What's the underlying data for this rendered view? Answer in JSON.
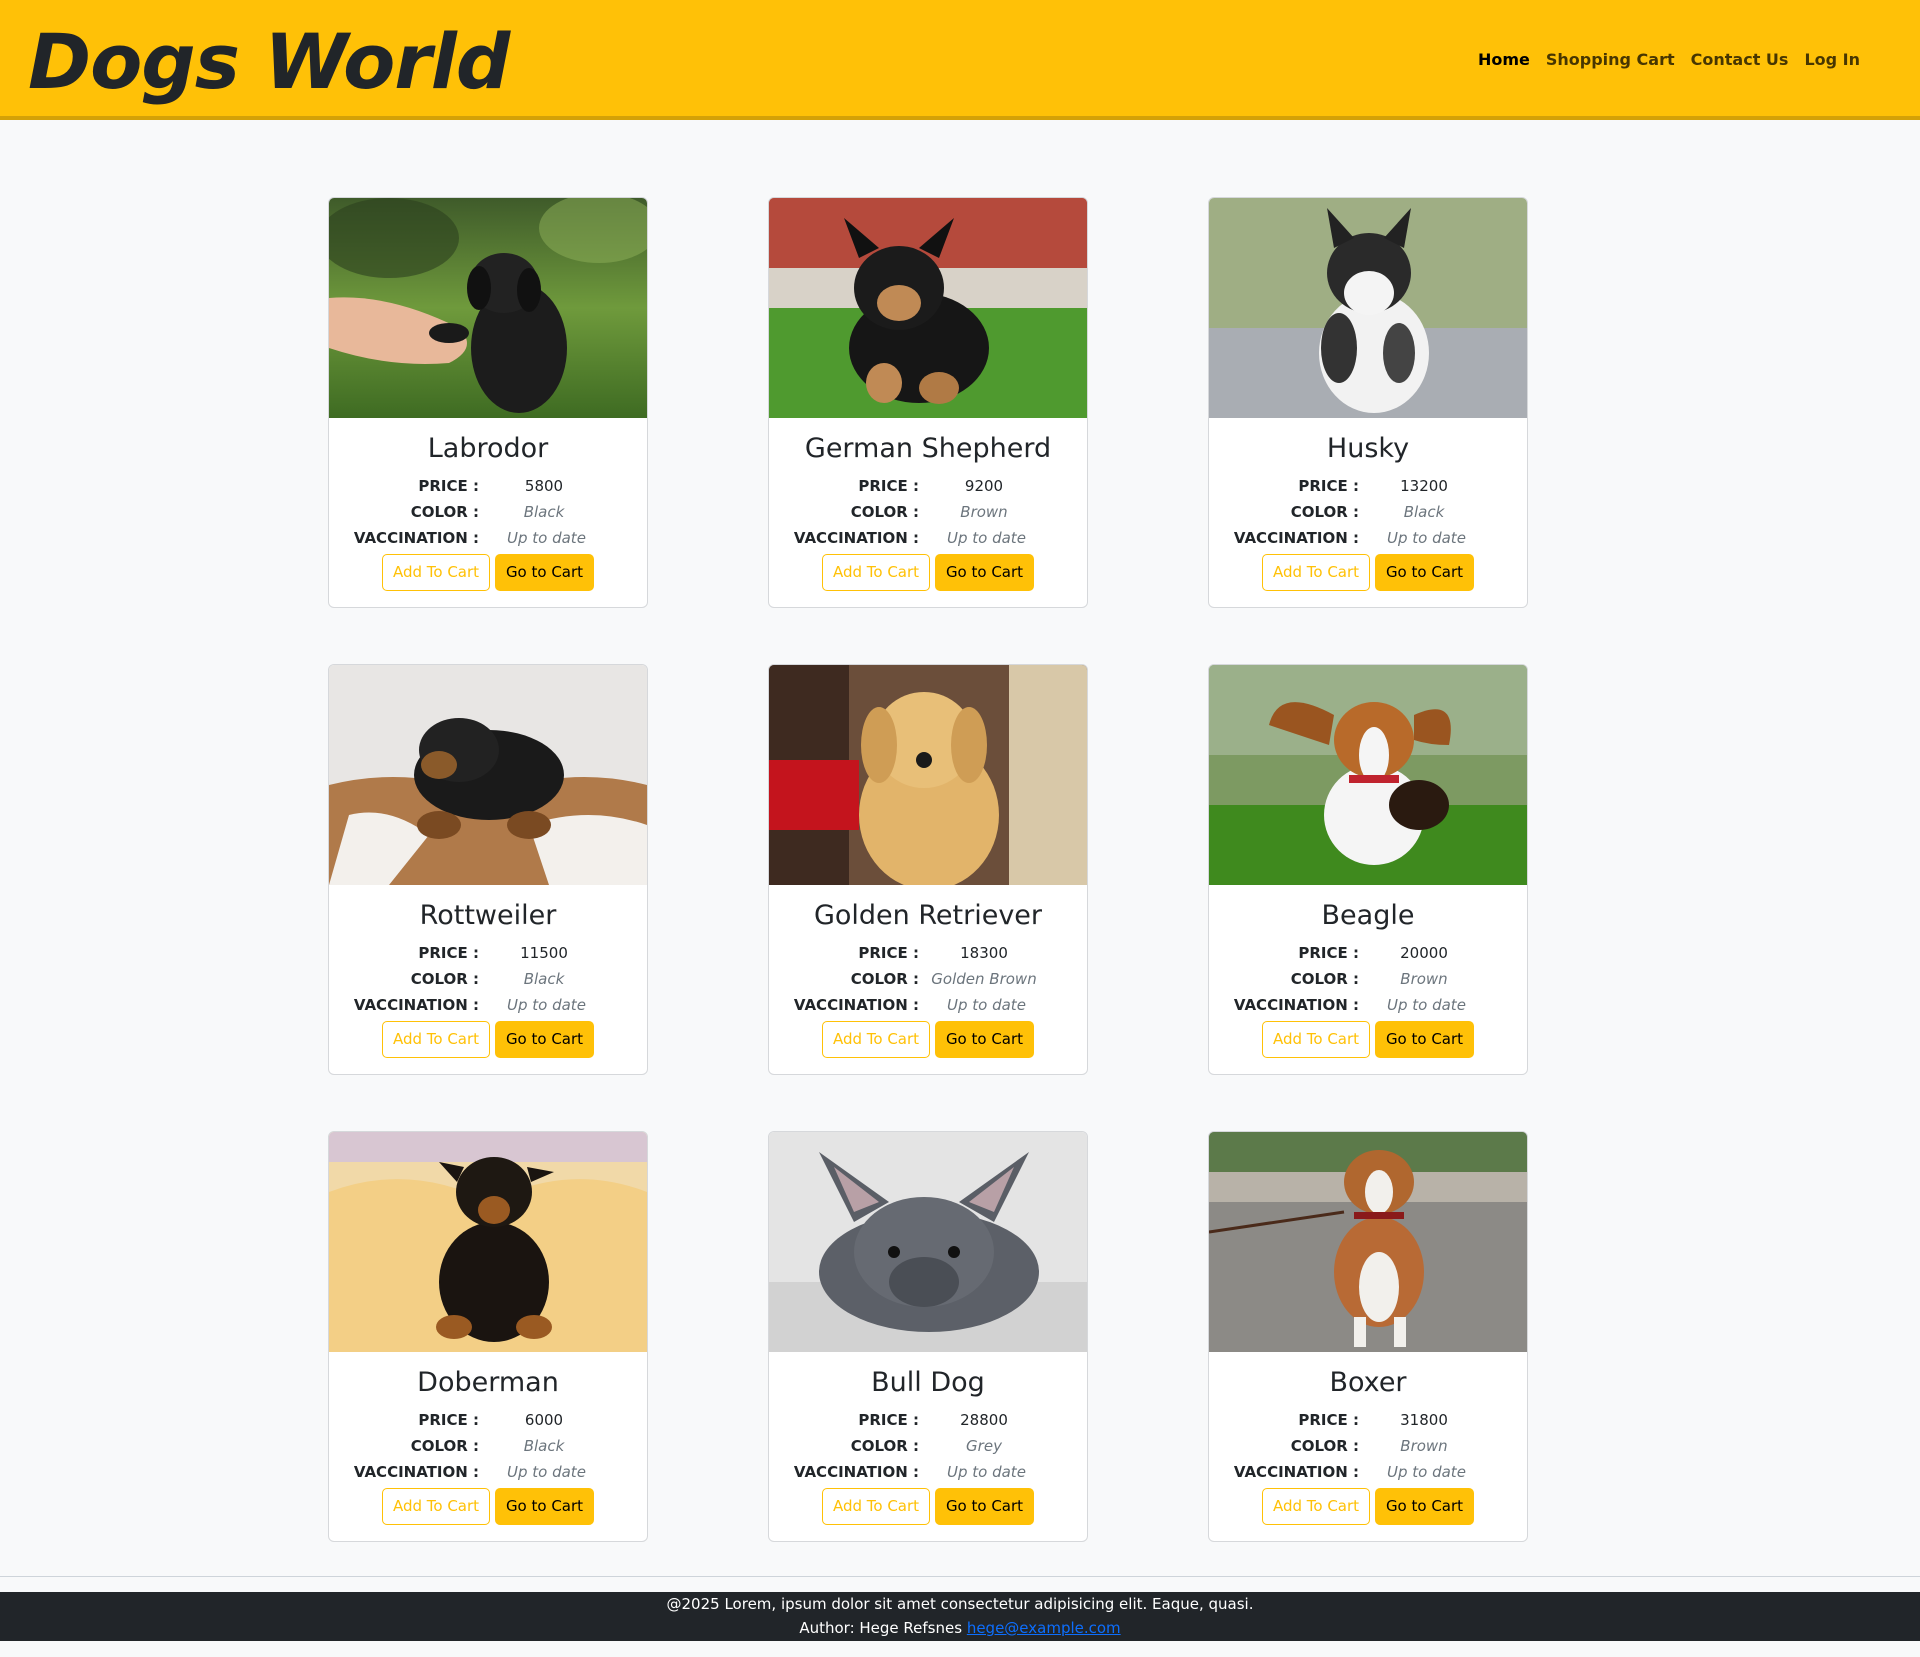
{
  "brand": "Dogs World",
  "nav": [
    {
      "label": "Home",
      "active": true
    },
    {
      "label": "Shopping Cart",
      "active": false
    },
    {
      "label": "Contact Us",
      "active": false
    },
    {
      "label": "Log In",
      "active": false
    }
  ],
  "labels": {
    "price": "PRICE :",
    "color": "COLOR :",
    "vaccination": "VACCINATION :",
    "add_button": "Add To Cart",
    "go_button": "Go to Cart"
  },
  "dogs": [
    {
      "name": "Labrodor",
      "price": "5800",
      "color": "Black",
      "vaccination": "Up to date",
      "image": "black-puppy-paw-in-hand"
    },
    {
      "name": "German Shepherd",
      "price": "9200",
      "color": "Brown",
      "vaccination": "Up to date",
      "image": "german-shepherd-puppy-on-grass"
    },
    {
      "name": "Husky",
      "price": "13200",
      "color": "Black",
      "vaccination": "Up to date",
      "image": "husky-puppy"
    },
    {
      "name": "Rottweiler",
      "price": "11500",
      "color": "Black",
      "vaccination": "Up to date",
      "image": "rottweiler-puppy-on-blanket"
    },
    {
      "name": "Golden Retriever",
      "price": "18300",
      "color": "Golden Brown",
      "vaccination": "Up to date",
      "image": "golden-retriever-puppy"
    },
    {
      "name": "Beagle",
      "price": "20000",
      "color": "Brown",
      "vaccination": "Up to date",
      "image": "beagle-running-on-grass"
    },
    {
      "name": "Doberman",
      "price": "6000",
      "color": "Black",
      "vaccination": "Up to date",
      "image": "doberman-puppy-on-cushion"
    },
    {
      "name": "Bull Dog",
      "price": "28800",
      "color": "Grey",
      "vaccination": "Up to date",
      "image": "french-bulldog-lying"
    },
    {
      "name": "Boxer",
      "price": "31800",
      "color": "Brown",
      "vaccination": "Up to date",
      "image": "boxer-puppy-on-leash"
    }
  ],
  "footer": {
    "line1": "@2025 Lorem, ipsum dolor sit amet consectetur adipisicing elit. Eaque, quasi.",
    "author_prefix": "Author: Hege Refsnes ",
    "email": "hege@example.com"
  },
  "colors": {
    "accent": "#ffc107",
    "footer_bg": "#212529",
    "page_bg": "#f8f9fa"
  }
}
